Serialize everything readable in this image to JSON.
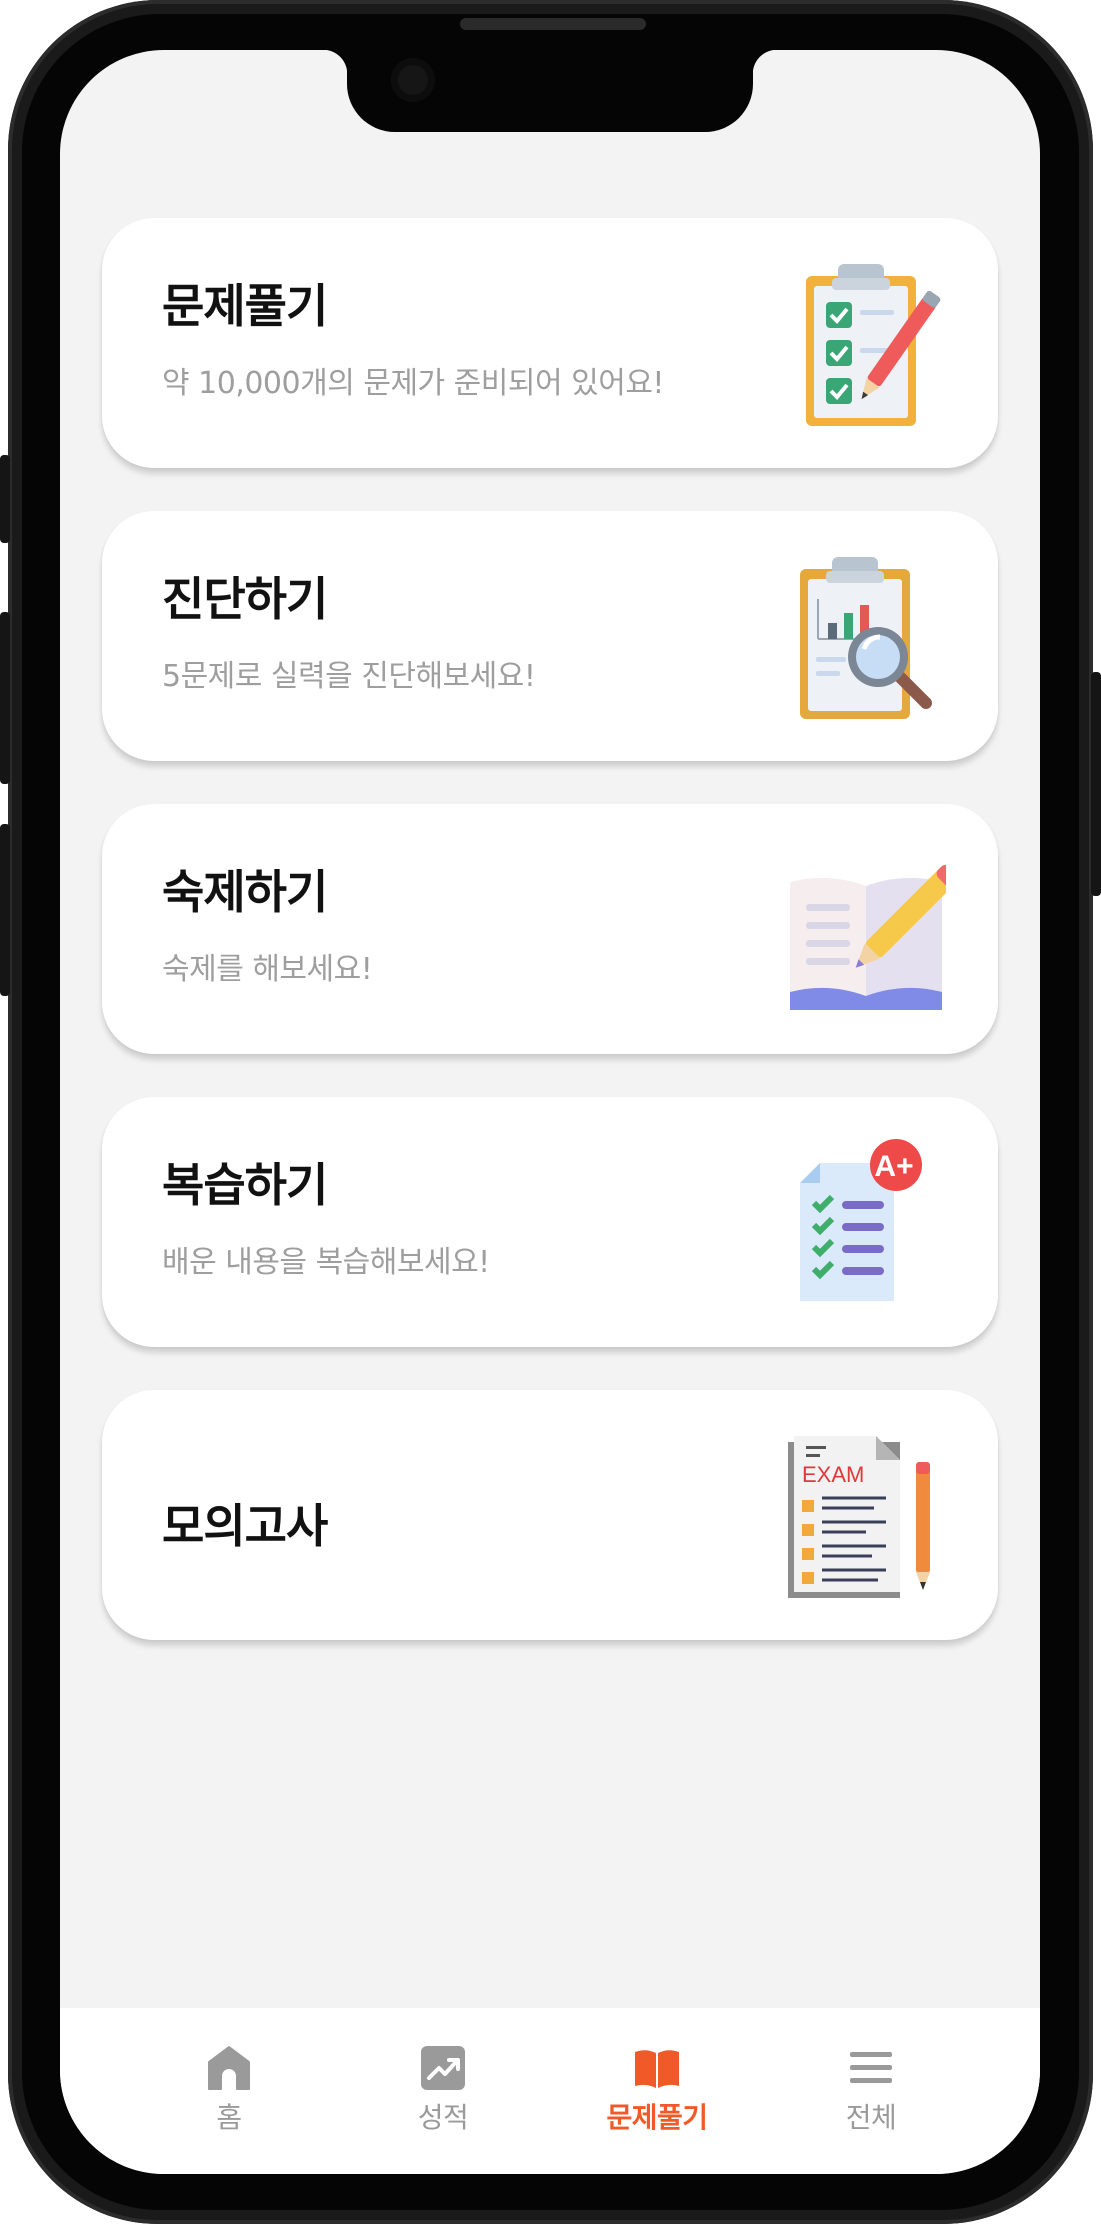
{
  "cards": [
    {
      "title": "문제풀기",
      "subtitle": "약 10,000개의 문제가 준비되어 있어요!",
      "icon": "clipboard-checklist-pencil-icon"
    },
    {
      "title": "진단하기",
      "subtitle": "5문제로 실력을 진단해보세요!",
      "icon": "clipboard-chart-magnifier-icon"
    },
    {
      "title": "숙제하기",
      "subtitle": "숙제를 해보세요!",
      "icon": "open-book-pencil-icon"
    },
    {
      "title": "복습하기",
      "subtitle": "배운 내용을 복습해보세요!",
      "icon": "checklist-a-plus-icon"
    },
    {
      "title": "모의고사",
      "subtitle": "",
      "icon": "exam-paper-pencil-icon"
    }
  ],
  "exam_icon_text": "EXAM",
  "grade_badge_text": "A+",
  "bottom_nav": {
    "active_color": "#f05a28",
    "inactive_color": "#9a9a9a",
    "items": [
      {
        "label": "홈",
        "icon": "home-icon",
        "active": false
      },
      {
        "label": "성적",
        "icon": "chart-trend-icon",
        "active": false
      },
      {
        "label": "문제풀기",
        "icon": "open-book-icon",
        "active": true
      },
      {
        "label": "전체",
        "icon": "menu-icon",
        "active": false
      }
    ]
  }
}
